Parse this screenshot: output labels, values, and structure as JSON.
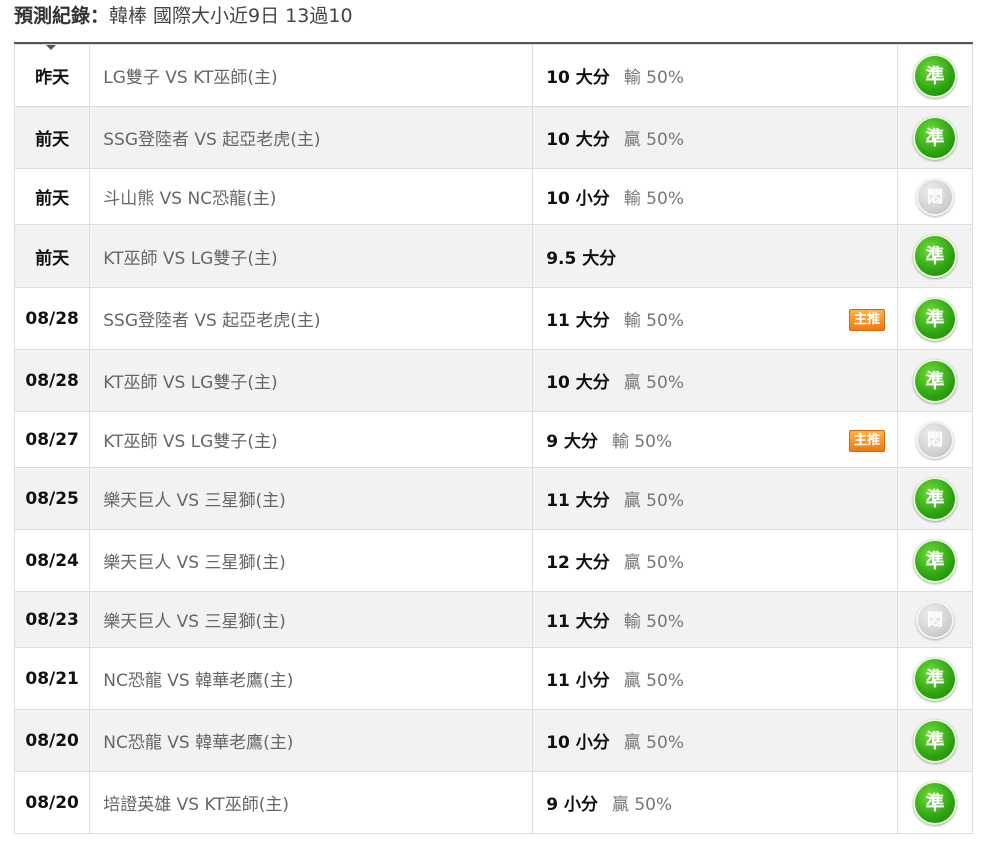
{
  "header": {
    "label": "預測紀錄：",
    "title": "韓棒 國際大小近9日 13過10"
  },
  "rows": [
    {
      "date": "昨天",
      "match": "LG雙子 VS KT巫師(主)",
      "pick": "10 大分",
      "sub": "輸 50%",
      "badge": "",
      "result": "準",
      "result_type": "win"
    },
    {
      "date": "前天",
      "match": "SSG登陸者 VS 起亞老虎(主)",
      "pick": "10 大分",
      "sub": "贏 50%",
      "badge": "",
      "result": "準",
      "result_type": "win"
    },
    {
      "date": "前天",
      "match": "斗山熊 VS NC恐龍(主)",
      "pick": "10 小分",
      "sub": "輸 50%",
      "badge": "",
      "result": "悶",
      "result_type": "lose"
    },
    {
      "date": "前天",
      "match": "KT巫師 VS LG雙子(主)",
      "pick": "9.5 大分",
      "sub": "",
      "badge": "",
      "result": "準",
      "result_type": "win"
    },
    {
      "date": "08/28",
      "match": "SSG登陸者 VS 起亞老虎(主)",
      "pick": "11 大分",
      "sub": "輸 50%",
      "badge": "主推",
      "result": "準",
      "result_type": "win"
    },
    {
      "date": "08/28",
      "match": "KT巫師 VS LG雙子(主)",
      "pick": "10 大分",
      "sub": "贏 50%",
      "badge": "",
      "result": "準",
      "result_type": "win"
    },
    {
      "date": "08/27",
      "match": "KT巫師 VS LG雙子(主)",
      "pick": "9 大分",
      "sub": "輸 50%",
      "badge": "主推",
      "result": "悶",
      "result_type": "lose"
    },
    {
      "date": "08/25",
      "match": "樂天巨人 VS 三星獅(主)",
      "pick": "11 大分",
      "sub": "贏 50%",
      "badge": "",
      "result": "準",
      "result_type": "win"
    },
    {
      "date": "08/24",
      "match": "樂天巨人 VS 三星獅(主)",
      "pick": "12 大分",
      "sub": "贏 50%",
      "badge": "",
      "result": "準",
      "result_type": "win"
    },
    {
      "date": "08/23",
      "match": "樂天巨人 VS 三星獅(主)",
      "pick": "11 大分",
      "sub": "輸 50%",
      "badge": "",
      "result": "悶",
      "result_type": "lose"
    },
    {
      "date": "08/21",
      "match": "NC恐龍 VS 韓華老鷹(主)",
      "pick": "11 小分",
      "sub": "贏 50%",
      "badge": "",
      "result": "準",
      "result_type": "win"
    },
    {
      "date": "08/20",
      "match": "NC恐龍 VS 韓華老鷹(主)",
      "pick": "10 小分",
      "sub": "贏 50%",
      "badge": "",
      "result": "準",
      "result_type": "win"
    },
    {
      "date": "08/20",
      "match": "培證英雄 VS KT巫師(主)",
      "pick": "9 小分",
      "sub": "贏 50%",
      "badge": "",
      "result": "準",
      "result_type": "win"
    }
  ],
  "colors": {
    "win": "#2ea312",
    "lose": "#bdbdbd",
    "badge": "#f08a1c"
  }
}
